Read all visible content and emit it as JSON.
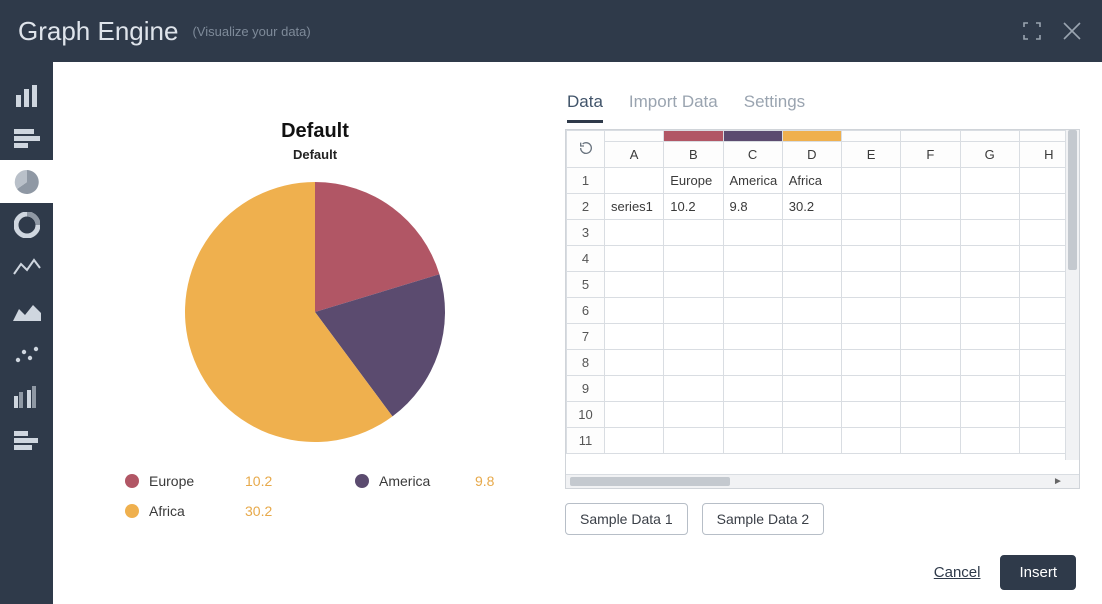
{
  "header": {
    "title": "Graph Engine",
    "tagline": "(Visualize your data)"
  },
  "sidebar": {
    "items": [
      {
        "name": "bar-chart-icon"
      },
      {
        "name": "stacked-bar-icon"
      },
      {
        "name": "pie-chart-icon",
        "active": true
      },
      {
        "name": "donut-chart-icon"
      },
      {
        "name": "line-chart-icon"
      },
      {
        "name": "area-chart-icon"
      },
      {
        "name": "scatter-chart-icon"
      },
      {
        "name": "grouped-bar-icon"
      },
      {
        "name": "horizontal-bar-icon"
      }
    ]
  },
  "chart": {
    "title": "Default",
    "subtitle": "Default"
  },
  "chart_data": {
    "type": "pie",
    "title": "Default",
    "subtitle": "Default",
    "series_name": "series1",
    "categories": [
      "Europe",
      "America",
      "Africa"
    ],
    "values": [
      10.2,
      9.8,
      30.2
    ],
    "colors": [
      "#b15665",
      "#5b4b6f",
      "#efb04e"
    ]
  },
  "tabs": {
    "items": [
      "Data",
      "Import Data",
      "Settings"
    ],
    "active": 0
  },
  "grid": {
    "columns": [
      "A",
      "B",
      "C",
      "D",
      "E",
      "F",
      "G",
      "H"
    ],
    "header_row": [
      "",
      "Europe",
      "America",
      "Africa",
      "",
      "",
      "",
      ""
    ],
    "data_row": [
      "series1",
      "10.2",
      "9.8",
      "30.2",
      "",
      "",
      "",
      ""
    ],
    "row_count_visible": 11,
    "column_colors": {
      "B": "#b15665",
      "C": "#5b4b6f",
      "D": "#efb04e"
    }
  },
  "buttons": {
    "sample1": "Sample Data 1",
    "sample2": "Sample Data 2",
    "cancel": "Cancel",
    "insert": "Insert"
  }
}
